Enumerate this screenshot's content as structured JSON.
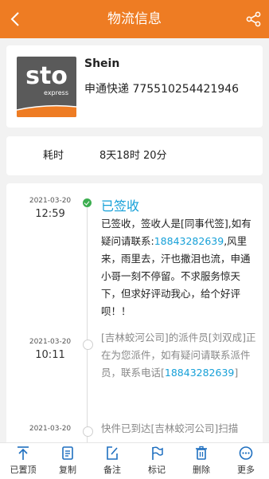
{
  "header": {
    "title": "物流信息"
  },
  "shipment": {
    "logo_text": "sto",
    "logo_subtext": "express",
    "shop_name": "Shein",
    "courier_tracking": "申通快递 775510254421946"
  },
  "duration": {
    "label": "耗时",
    "value": "8天18时 20分"
  },
  "timeline": [
    {
      "date": "2021-03-20",
      "time": "12:59",
      "status": "已签收",
      "text_before": "已签收，签收人是[同事代签],如有疑问请联系:",
      "phone": "18843282639",
      "text_after": ",风里来，雨里去，汗也撒泪也流，申通小哥一刻不停留。不求服务惊天下，但求好评动我心，给个好评呗！！"
    },
    {
      "date": "2021-03-20",
      "time": "10:11",
      "text_before": "[吉林蛟河公司]的派件员[刘双成]正在为您派件，如有疑问请联系派件员，联系电话[",
      "phone": "18843282639",
      "text_after": "]"
    },
    {
      "date": "2021-03-20",
      "time": "",
      "text_before": "快件已到达[吉林蛟河公司]扫描"
    }
  ],
  "toolbar": [
    {
      "label": "已置顶",
      "icon": "pin-top-icon"
    },
    {
      "label": "复制",
      "icon": "copy-icon"
    },
    {
      "label": "备注",
      "icon": "edit-note-icon"
    },
    {
      "label": "标记",
      "icon": "flag-icon"
    },
    {
      "label": "删除",
      "icon": "trash-icon"
    },
    {
      "label": "更多",
      "icon": "more-icon"
    }
  ],
  "colors": {
    "brand": "#ee7c23",
    "link": "#16a0d8",
    "success": "#3cae50",
    "toolbar_icon": "#1e6fc0"
  }
}
